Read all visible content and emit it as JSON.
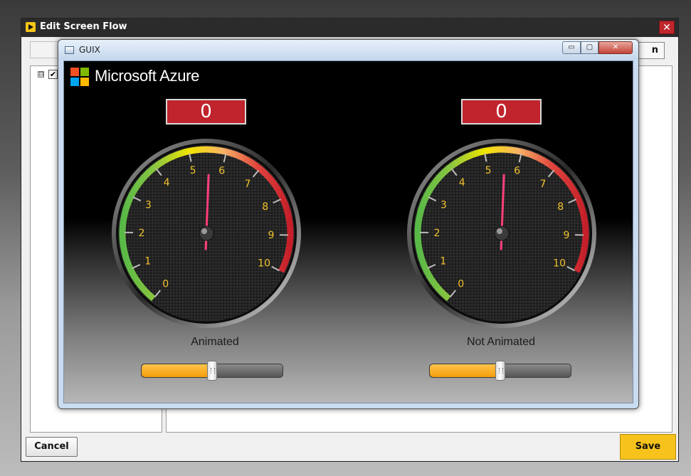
{
  "outer_dialog": {
    "title": "Edit Screen Flow",
    "close_label": "✕",
    "partial_button_text": "n",
    "cancel_label": "Cancel",
    "save_label": "Save",
    "tree_expander": "⊟",
    "tree_check": "✔"
  },
  "guix_window": {
    "title": "GUIX",
    "min_label": "▭",
    "max_label": "▢",
    "close_label": "✕"
  },
  "brand": {
    "name": "Microsoft Azure",
    "logo_colors": [
      "#f25022",
      "#7fba00",
      "#00a4ef",
      "#ffb900"
    ]
  },
  "gauges": [
    {
      "value_display": "0",
      "label": "Animated",
      "tick_labels": [
        "0",
        "1",
        "2",
        "3",
        "4",
        "5",
        "6",
        "7",
        "8",
        "9",
        "10"
      ],
      "needle_value": 5.55,
      "slider_fraction": 0.5
    },
    {
      "value_display": "0",
      "label": "Not Animated",
      "tick_labels": [
        "0",
        "1",
        "2",
        "3",
        "4",
        "5",
        "6",
        "7",
        "8",
        "9",
        "10"
      ],
      "needle_value": 5.55,
      "slider_fraction": 0.5
    }
  ],
  "colors": {
    "value_box": "#c0242d",
    "tick_label": "#f2c32e",
    "needle": "#ff3f7a",
    "slider_fill": "#f59e0b",
    "save_button": "#f7c21b",
    "arc_stops": [
      "#58b947",
      "#8cc63f",
      "#f2e500",
      "#f7b267",
      "#e0453d",
      "#c41f2a"
    ]
  }
}
